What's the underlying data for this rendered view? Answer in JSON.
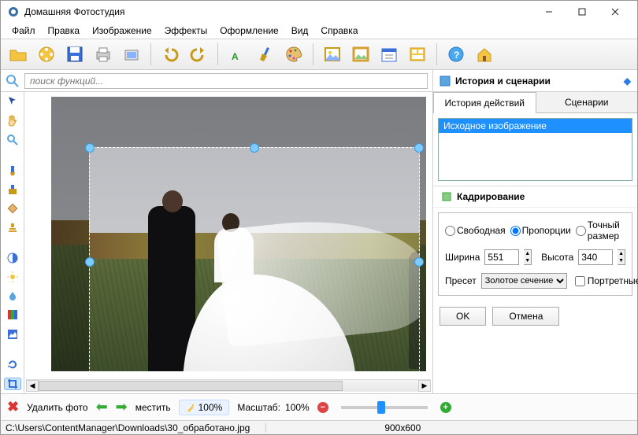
{
  "window": {
    "title": "Домашняя Фотостудия"
  },
  "menu": [
    "Файл",
    "Правка",
    "Изображение",
    "Эффекты",
    "Оформление",
    "Вид",
    "Справка"
  ],
  "search": {
    "placeholder": "поиск функций..."
  },
  "right_header": "История и сценарии",
  "tabs": {
    "history": "История действий",
    "scenarios": "Сценарии"
  },
  "history": {
    "items": [
      "Исходное изображение"
    ]
  },
  "crop_panel": {
    "title": "Кадрирование",
    "mode_free": "Свободная",
    "mode_prop": "Пропорции",
    "mode_exact": "Точный размер",
    "width_label": "Ширина",
    "width_value": "551",
    "height_label": "Высота",
    "height_value": "340",
    "preset_label": "Пресет",
    "preset_value": "Золотое сечение",
    "portrait_label": "Портретные",
    "ok": "OK",
    "cancel": "Отмена"
  },
  "bottom": {
    "delete_label": "Удалить фото",
    "move_label": "местить",
    "zoom_chip": "100%",
    "scale_label": "Масштаб:",
    "scale_value": "100%"
  },
  "status": {
    "path": "C:\\Users\\ContentManager\\Downloads\\30_обработано.jpg",
    "dims": "900x600"
  }
}
